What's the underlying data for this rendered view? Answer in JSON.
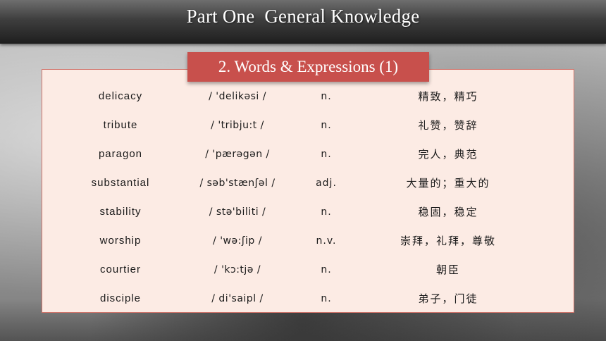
{
  "header": {
    "title": "Part One  General Knowledge"
  },
  "section": {
    "title": "2. Words & Expressions (1)"
  },
  "vocabulary": [
    {
      "word": "delicacy",
      "phonetic": "/ 'delikəsi /",
      "pos": "n.",
      "definition": "精致，精巧"
    },
    {
      "word": "tribute",
      "phonetic": "/ 'tribju:t /",
      "pos": "n.",
      "definition": "礼赞，赞辞"
    },
    {
      "word": "paragon",
      "phonetic": "/ 'pærəgən /",
      "pos": "n.",
      "definition": "完人，典范"
    },
    {
      "word": "substantial",
      "phonetic": "/ səb'stænʃəl /",
      "pos": "adj.",
      "definition": "大量的；重大的"
    },
    {
      "word": "stability",
      "phonetic": "/ stə'biliti /",
      "pos": "n.",
      "definition": "稳固，稳定"
    },
    {
      "word": "worship",
      "phonetic": "/ 'wə:ʃip /",
      "pos": "n.v.",
      "definition": "崇拜，礼拜，尊敬"
    },
    {
      "word": "courtier",
      "phonetic": "/ 'kɔ:tjə /",
      "pos": "n.",
      "definition": "朝臣"
    },
    {
      "word": "disciple",
      "phonetic": "/ di'saipl /",
      "pos": "n.",
      "definition": "弟子，门徒"
    }
  ],
  "colors": {
    "header_bg": "#2e2e2e",
    "subtitle_bg": "#c8504c",
    "panel_bg": "#fcebe4",
    "panel_border": "#d0736a"
  }
}
